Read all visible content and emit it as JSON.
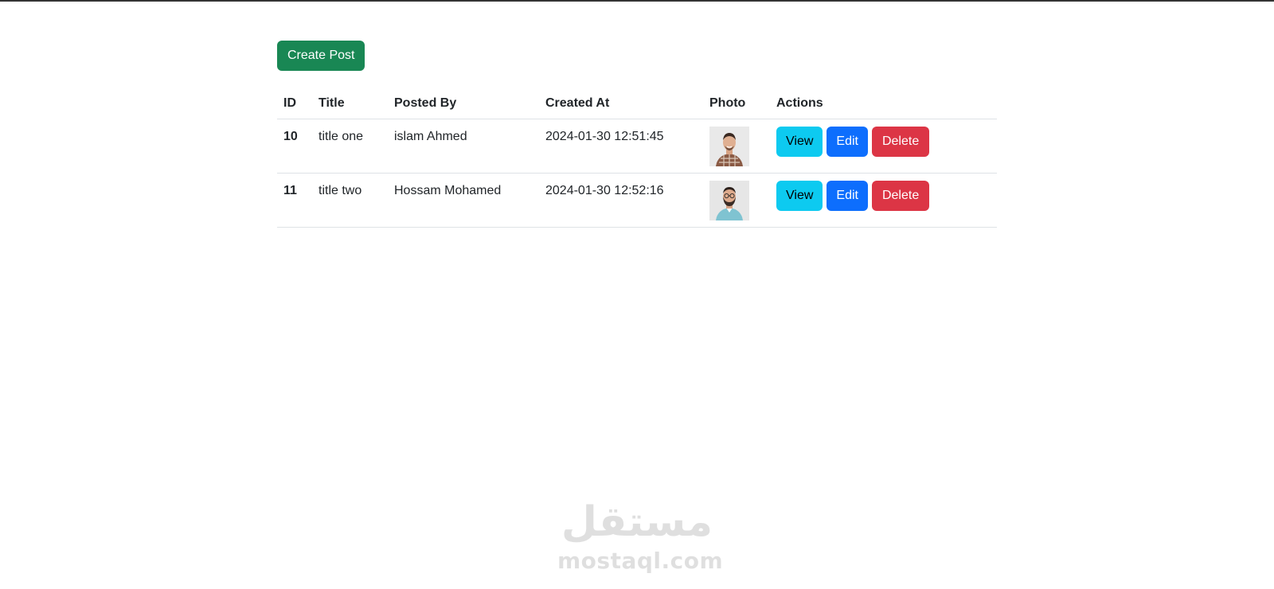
{
  "toolbar": {
    "create_label": "Create Post"
  },
  "table": {
    "headers": [
      "ID",
      "Title",
      "Posted By",
      "Created At",
      "Photo",
      "Actions"
    ],
    "rows": [
      {
        "id": "10",
        "title": "title one",
        "posted_by": "islam Ahmed",
        "created_at": "2024-01-30 12:51:45",
        "photo": "avatar-man-checkered-shirt",
        "actions": {
          "view": "View",
          "edit": "Edit",
          "delete": "Delete"
        }
      },
      {
        "id": "11",
        "title": "title two",
        "posted_by": "Hossam Mohamed",
        "created_at": "2024-01-30 12:52:16",
        "photo": "avatar-man-glasses",
        "actions": {
          "view": "View",
          "edit": "Edit",
          "delete": "Delete"
        }
      }
    ]
  },
  "watermark": {
    "logo_text": "مستقل",
    "site_text": "mostaql.com"
  },
  "colors": {
    "success": "#198754",
    "info": "#0dcaf0",
    "primary": "#0d6efd",
    "danger": "#dc3545",
    "border": "#dee2e6"
  }
}
